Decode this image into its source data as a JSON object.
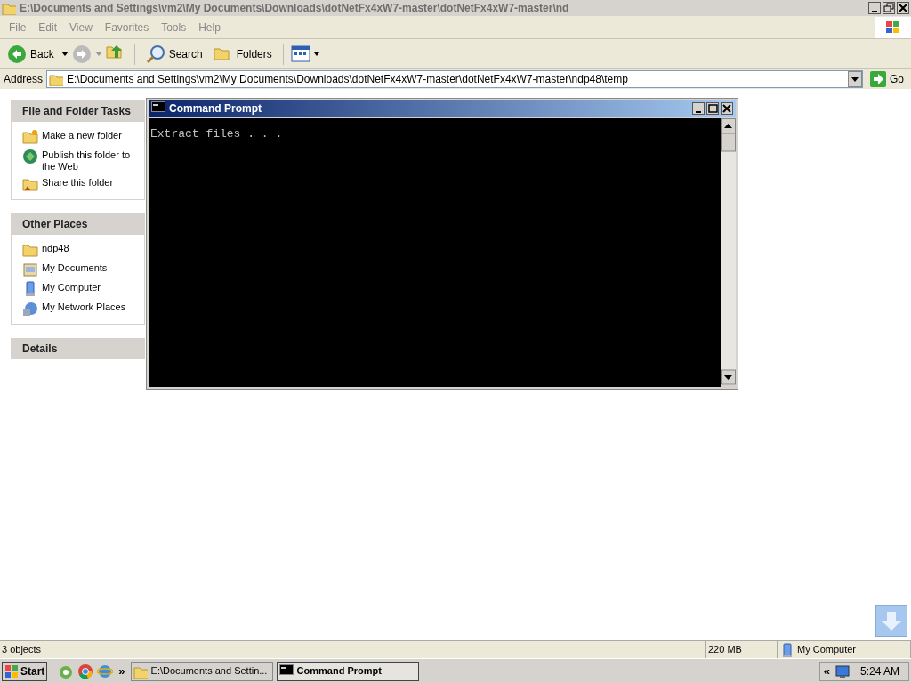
{
  "explorer": {
    "title": "E:\\Documents and Settings\\vm2\\My Documents\\Downloads\\dotNetFx4xW7-master\\dotNetFx4xW7-master\\nd",
    "menu": [
      "File",
      "Edit",
      "View",
      "Favorites",
      "Tools",
      "Help"
    ],
    "toolbar": {
      "back": "Back",
      "search": "Search",
      "folders": "Folders"
    },
    "address": {
      "label": "Address",
      "value": "E:\\Documents and Settings\\vm2\\My Documents\\Downloads\\dotNetFx4xW7-master\\dotNetFx4xW7-master\\ndp48\\temp",
      "go": "Go"
    },
    "panels": [
      {
        "title": "File and Folder Tasks",
        "items": [
          {
            "label": "Make a new folder",
            "kind": "newfolder"
          },
          {
            "label": "Publish this folder to the Web",
            "kind": "globe"
          },
          {
            "label": "Share this folder",
            "kind": "share"
          }
        ]
      },
      {
        "title": "Other Places",
        "items": [
          {
            "label": "ndp48",
            "kind": "folder"
          },
          {
            "label": "My Documents",
            "kind": "documents"
          },
          {
            "label": "My Computer",
            "kind": "computer"
          },
          {
            "label": "My Network Places",
            "kind": "network"
          }
        ]
      },
      {
        "title": "Details"
      }
    ],
    "status_bar": [
      "3 objects",
      "220 MB",
      "My Computer"
    ]
  },
  "console": {
    "title": "Command Prompt",
    "lines": [
      "Extract files . . ."
    ]
  },
  "taskbar": {
    "start": "Start",
    "chevron": "»",
    "buttons": [
      {
        "label": "E:\\Documents and Settin...",
        "kind": "folder",
        "selected": false
      },
      {
        "label": "Command Prompt",
        "kind": "console",
        "selected": true
      }
    ],
    "tray_chevron": "«",
    "clock": "5:24 AM"
  }
}
